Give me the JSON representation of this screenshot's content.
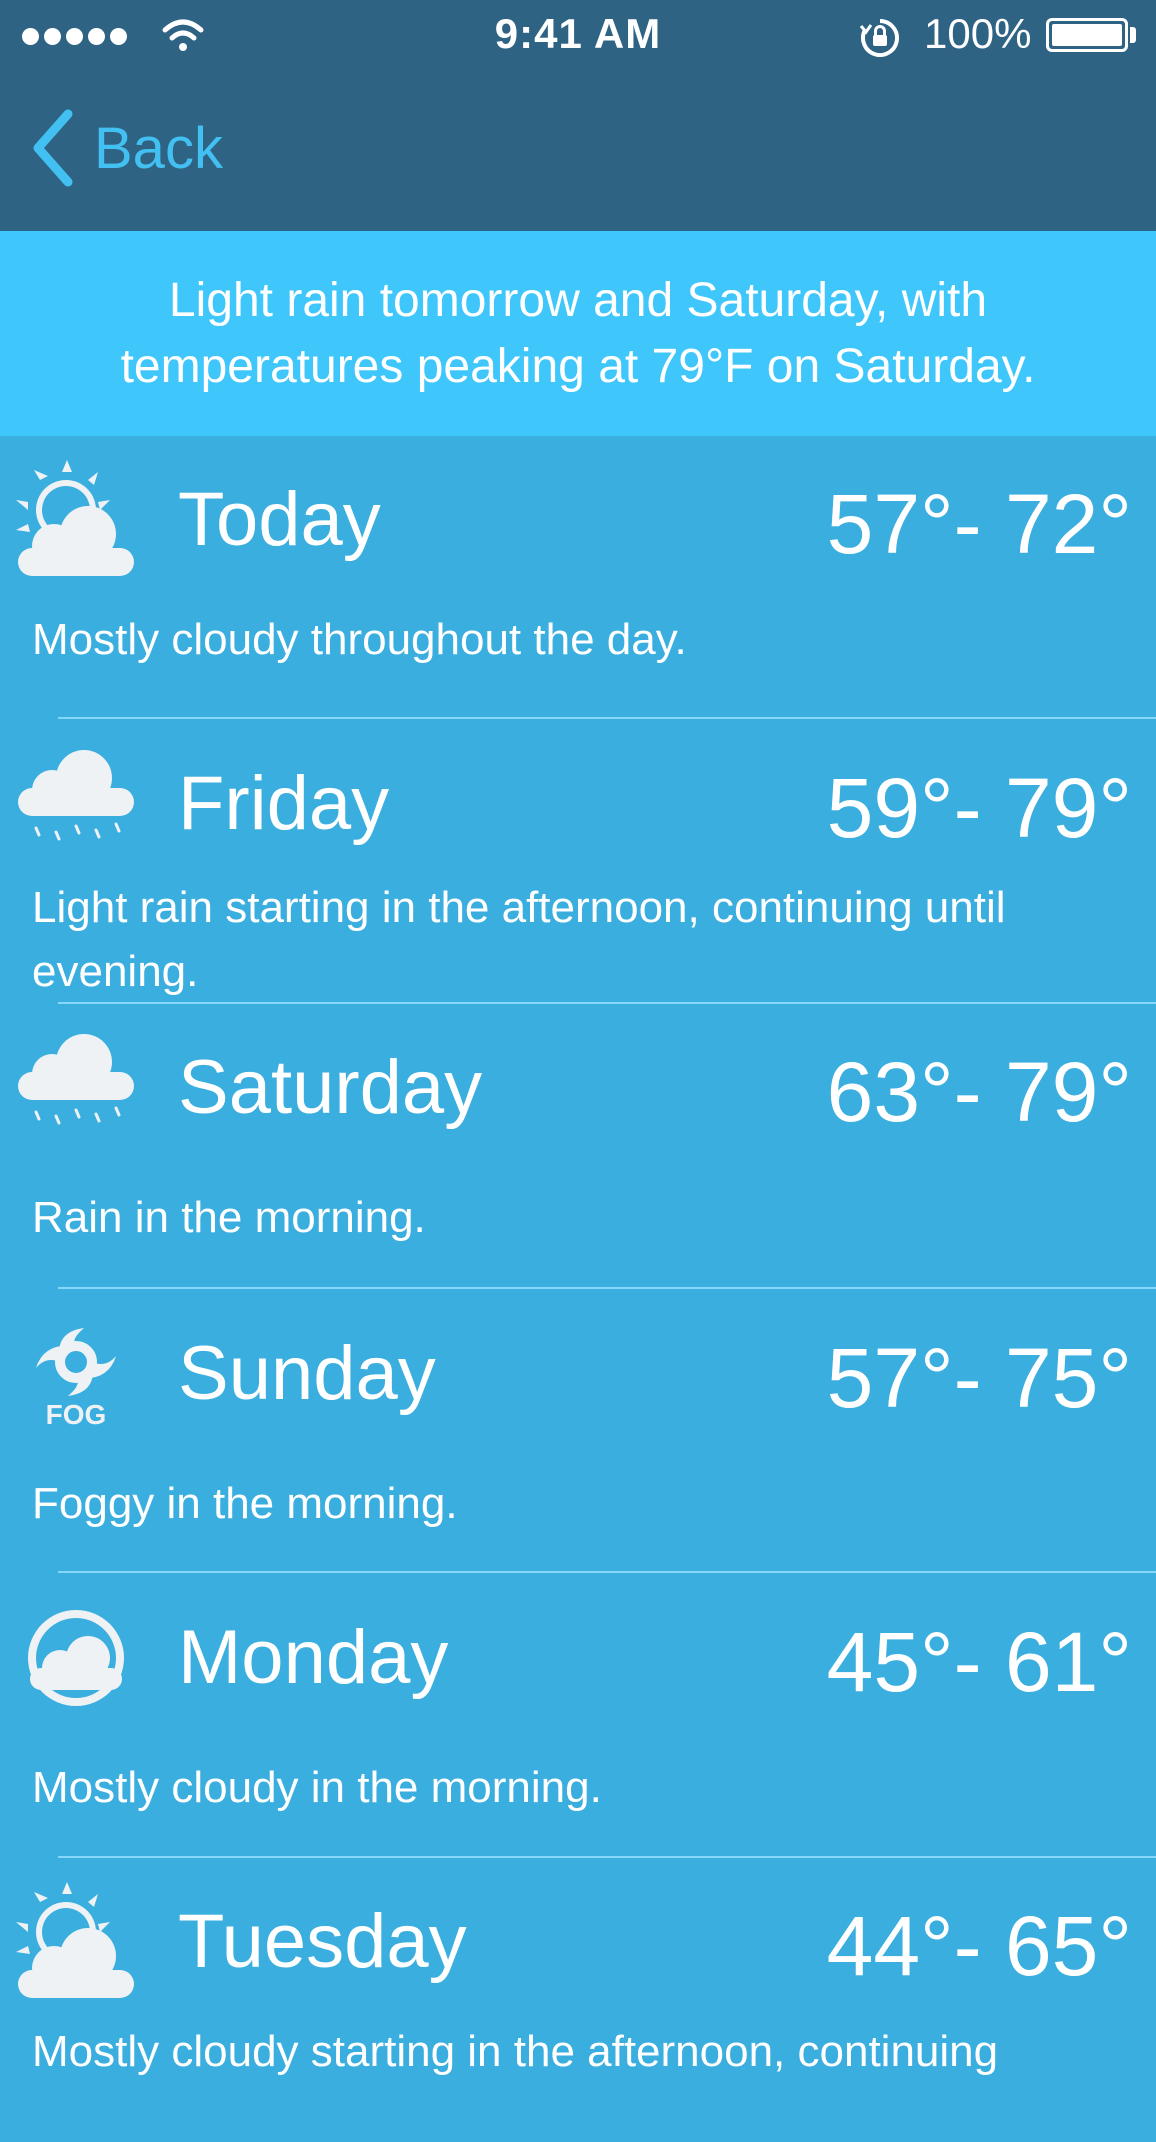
{
  "status_bar": {
    "time": "9:41 AM",
    "battery_percent": "100%"
  },
  "nav": {
    "back_label": "Back"
  },
  "summary": "Light rain tomorrow and Saturday, with temperatures peaking at 79°F on Saturday.",
  "days": [
    {
      "name": "Today",
      "range": "57°- 72°",
      "description": "Mostly cloudy throughout the day.",
      "icon": "partly-cloudy-day-icon"
    },
    {
      "name": "Friday",
      "range": "59°- 79°",
      "description": "Light rain starting in the afternoon, continuing until evening.",
      "icon": "rain-icon"
    },
    {
      "name": "Saturday",
      "range": "63°- 79°",
      "description": "Rain in the morning.",
      "icon": "rain-icon"
    },
    {
      "name": "Sunday",
      "range": "57°- 75°",
      "description": "Foggy in the morning.",
      "icon": "fog-icon",
      "icon_text": "FOG"
    },
    {
      "name": "Monday",
      "range": "45°- 61°",
      "description": "Mostly cloudy in the morning.",
      "icon": "partly-cloudy-night-icon"
    },
    {
      "name": "Tuesday",
      "range": "44°- 65°",
      "description": "Mostly cloudy starting in the afternoon, continuing",
      "icon": "partly-cloudy-day-icon"
    }
  ]
}
